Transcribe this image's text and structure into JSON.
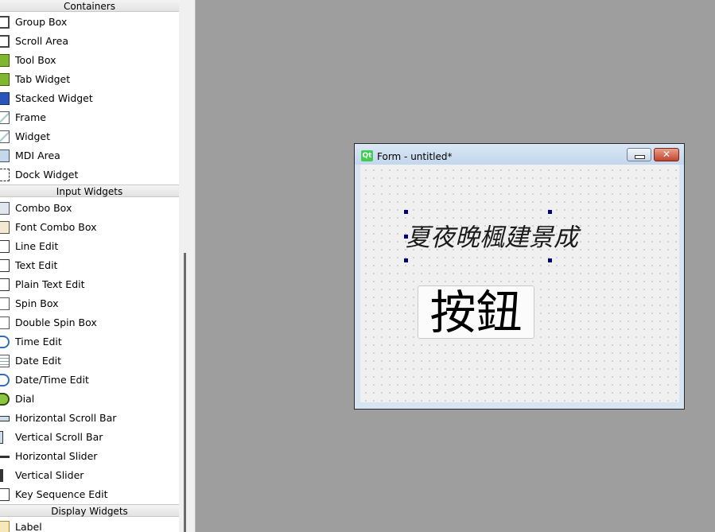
{
  "widget_box": {
    "categories": [
      {
        "title": "Containers",
        "items": [
          {
            "label": "Group Box",
            "icon": "group-box-icon"
          },
          {
            "label": "Scroll Area",
            "icon": "scroll-area-icon"
          },
          {
            "label": "Tool Box",
            "icon": "tool-box-icon"
          },
          {
            "label": "Tab Widget",
            "icon": "tab-widget-icon"
          },
          {
            "label": "Stacked Widget",
            "icon": "stacked-widget-icon"
          },
          {
            "label": "Frame",
            "icon": "frame-icon"
          },
          {
            "label": "Widget",
            "icon": "widget-icon"
          },
          {
            "label": "MDI Area",
            "icon": "mdi-area-icon"
          },
          {
            "label": "Dock Widget",
            "icon": "dock-widget-icon"
          }
        ]
      },
      {
        "title": "Input Widgets",
        "items": [
          {
            "label": "Combo Box",
            "icon": "combo-box-icon"
          },
          {
            "label": "Font Combo Box",
            "icon": "font-combo-box-icon"
          },
          {
            "label": "Line Edit",
            "icon": "line-edit-icon"
          },
          {
            "label": "Text Edit",
            "icon": "text-edit-icon"
          },
          {
            "label": "Plain Text Edit",
            "icon": "plain-text-edit-icon"
          },
          {
            "label": "Spin Box",
            "icon": "spin-box-icon"
          },
          {
            "label": "Double Spin Box",
            "icon": "double-spin-box-icon"
          },
          {
            "label": "Time Edit",
            "icon": "time-edit-icon"
          },
          {
            "label": "Date Edit",
            "icon": "date-edit-icon"
          },
          {
            "label": "Date/Time Edit",
            "icon": "date-time-edit-icon"
          },
          {
            "label": "Dial",
            "icon": "dial-icon"
          },
          {
            "label": "Horizontal Scroll Bar",
            "icon": "horizontal-scroll-bar-icon"
          },
          {
            "label": "Vertical Scroll Bar",
            "icon": "vertical-scroll-bar-icon"
          },
          {
            "label": "Horizontal Slider",
            "icon": "horizontal-slider-icon"
          },
          {
            "label": "Vertical Slider",
            "icon": "vertical-slider-icon"
          },
          {
            "label": "Key Sequence Edit",
            "icon": "key-sequence-edit-icon"
          }
        ]
      },
      {
        "title": "Display Widgets",
        "items": [
          {
            "label": "Label",
            "icon": "label-icon"
          }
        ]
      }
    ]
  },
  "form_window": {
    "qt_logo": "Qt",
    "title": "Form - untitled*",
    "minimize_glyph": "",
    "close_glyph": "✕",
    "label_text": "夏夜晚楓建景成",
    "button_text": "按鈕"
  },
  "colors": {
    "canvas_background": "#9e9e9e",
    "selection_handle": "#00007a",
    "close_button": "#c1462c"
  }
}
